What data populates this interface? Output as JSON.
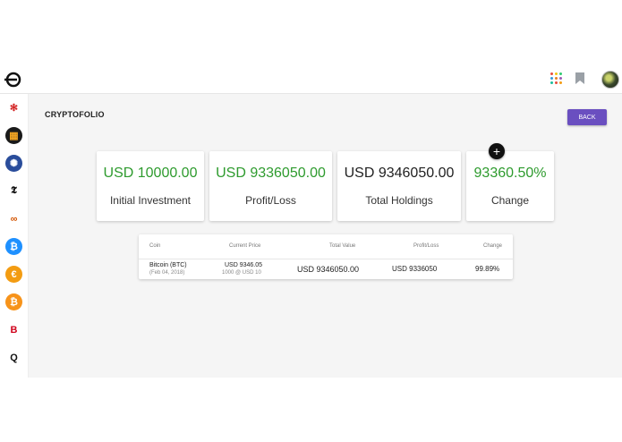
{
  "page": {
    "title": "CRYPTOFOLIO",
    "back_label": "BACK"
  },
  "topbar": {
    "logo": "cryptofolio-logo",
    "icons": [
      "apps-grid-icon",
      "bookmark-icon",
      "user-avatar"
    ]
  },
  "sidebar": {
    "items": [
      {
        "name": "yelp-icon",
        "glyph": "✻",
        "color": "#d32323",
        "bg": "#ffffff"
      },
      {
        "name": "digital-icon",
        "glyph": "▦",
        "color": "#f5a623",
        "bg": "#1a1a1a"
      },
      {
        "name": "nbc-icon",
        "glyph": "✺",
        "color": "#ffffff",
        "bg": "#2a4d9b"
      },
      {
        "name": "nyt-icon",
        "glyph": "𝕿",
        "color": "#111111",
        "bg": "#ffffff"
      },
      {
        "name": "rings-icon",
        "glyph": "∞",
        "color": "#d35400",
        "bg": "#ffffff"
      },
      {
        "name": "bitcoin-blue-icon",
        "glyph": "₿",
        "color": "#ffffff",
        "bg": "#1e90ff"
      },
      {
        "name": "euro-coin-icon",
        "glyph": "€",
        "color": "#ffffff",
        "bg": "#f39c12"
      },
      {
        "name": "bitcoin-icon",
        "glyph": "₿",
        "color": "#ffffff",
        "bg": "#f7931a"
      },
      {
        "name": "b-brand-icon",
        "glyph": "B",
        "color": "#d0021b",
        "bg": "#ffffff"
      },
      {
        "name": "quora-icon",
        "glyph": "Q",
        "color": "#111111",
        "bg": "#ffffff"
      }
    ]
  },
  "cards": [
    {
      "value": "USD 10000.00",
      "label": "Initial Investment",
      "accent": "green"
    },
    {
      "value": "USD 9336050.00",
      "label": "Profit/Loss",
      "accent": "green"
    },
    {
      "value": "USD 9346050.00",
      "label": "Total Holdings",
      "accent": "dark"
    },
    {
      "value": "93360.50%",
      "label": "Change",
      "accent": "green"
    }
  ],
  "table": {
    "headers": {
      "coin": "Coin",
      "price": "Current Price",
      "value": "Total Value",
      "pl": "Profit/Loss",
      "change": "Change"
    },
    "rows": [
      {
        "coin": "Bitcoin (BTC)",
        "date": "(Feb 04, 2018)",
        "price": "USD 9346.05",
        "price_sub": "1000 @ USD 10",
        "value": "USD 9346050.00",
        "pl": "USD 9336050",
        "change": "99.89%"
      }
    ]
  },
  "add_label": "+",
  "colors": {
    "accent": "#6a4fc0",
    "positive": "#2e9b2e"
  }
}
